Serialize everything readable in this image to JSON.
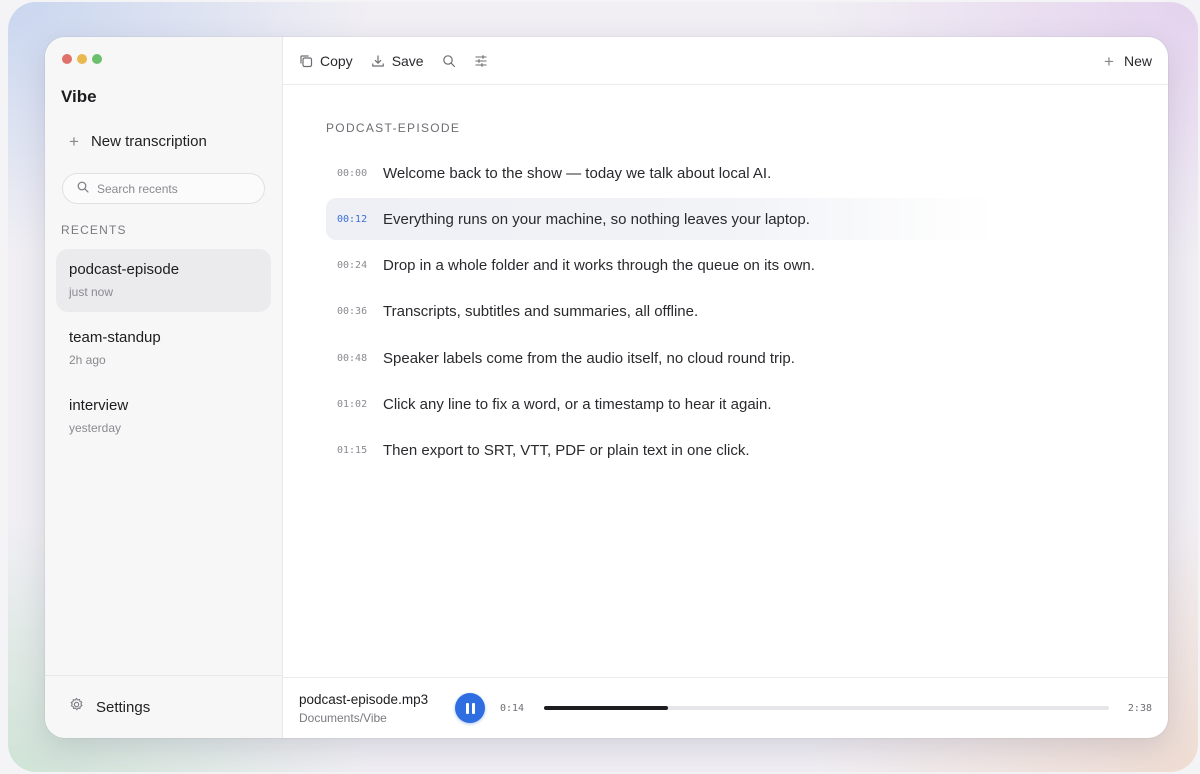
{
  "app": {
    "title": "Vibe"
  },
  "sidebar": {
    "new_transcription": "New transcription",
    "search_placeholder": "Search recents",
    "recents_label": "RECENTS",
    "recents": [
      {
        "name": "podcast-episode",
        "time": "just now",
        "active": true
      },
      {
        "name": "team-standup",
        "time": "2h ago",
        "active": false
      },
      {
        "name": "interview",
        "time": "yesterday",
        "active": false
      }
    ],
    "settings": "Settings"
  },
  "toolbar": {
    "copy": "Copy",
    "save": "Save",
    "new": "New"
  },
  "document": {
    "title": "PODCAST-EPISODE",
    "lines": [
      {
        "ts": "00:00",
        "text": "Welcome back to the show — today we talk about local AI."
      },
      {
        "ts": "00:12",
        "text": "Everything runs on your machine, so nothing leaves your laptop."
      },
      {
        "ts": "00:24",
        "text": "Drop in a whole folder and it works through the queue on its own."
      },
      {
        "ts": "00:36",
        "text": "Transcripts, subtitles and summaries, all offline."
      },
      {
        "ts": "00:48",
        "text": "Speaker labels come from the audio itself, no cloud round trip."
      },
      {
        "ts": "01:02",
        "text": "Click any line to fix a word, or a timestamp to hear it again."
      },
      {
        "ts": "01:15",
        "text": "Then export to SRT, VTT, PDF or plain text in one click."
      }
    ]
  },
  "player": {
    "file_name": "podcast-episode.mp3",
    "file_path": "Documents/Vibe",
    "current_time": "0:14",
    "total_time": "2:38",
    "progress": 0.22
  },
  "colors": {
    "accent": "#2f6ee0",
    "traffic_red": "#e0706a",
    "traffic_yellow": "#e9b84f",
    "traffic_green": "#6cbf6c"
  }
}
